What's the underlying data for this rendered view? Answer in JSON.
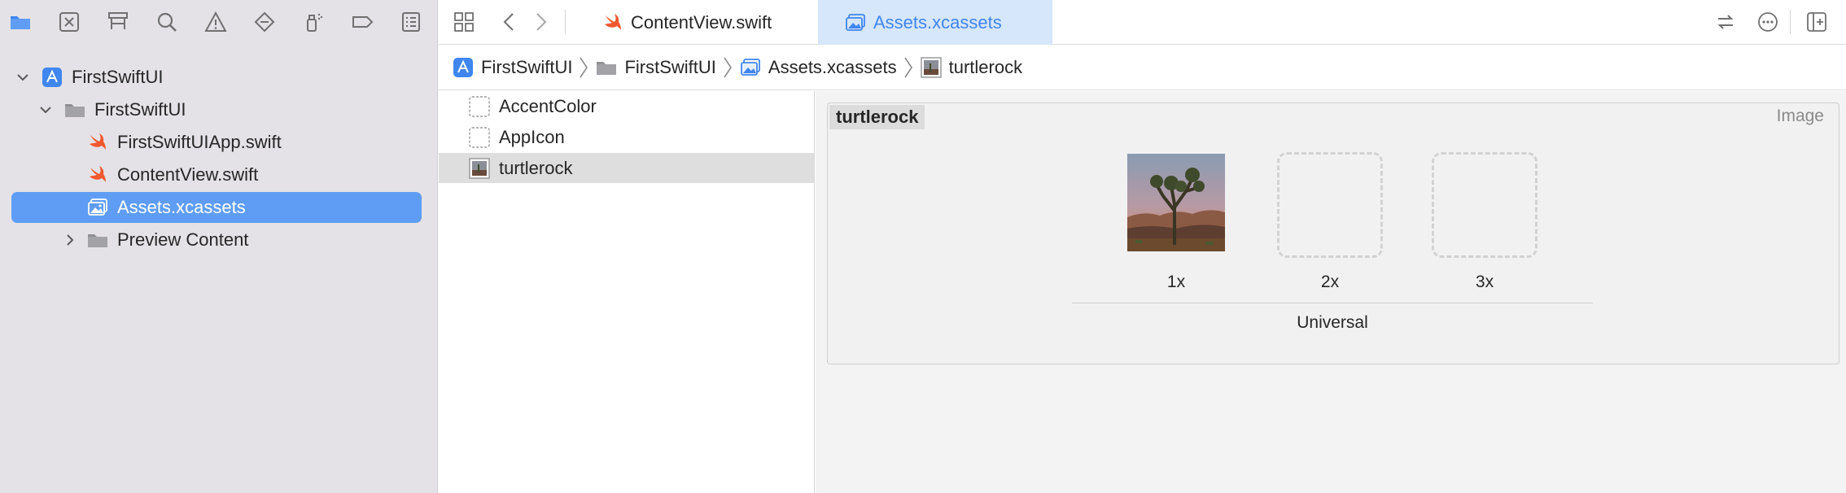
{
  "colors": {
    "accent": "#5e9df3",
    "swift": "#f0582d",
    "folder": "#8f8f94",
    "tab_active_bg": "#d6e6fb",
    "tab_active_text": "#3f86ee"
  },
  "navigator": {
    "toolbar_icons": [
      "folder-icon",
      "source-control-icon",
      "hierarchy-icon",
      "search-icon",
      "warning-icon",
      "test-diamond-icon",
      "debug-spray-icon",
      "breakpoint-icon",
      "report-icon"
    ],
    "tree": [
      {
        "label": "FirstSwiftUI",
        "icon": "xcode-project-icon",
        "expanded": true
      },
      {
        "label": "FirstSwiftUI",
        "icon": "folder-icon",
        "expanded": true
      },
      {
        "label": "FirstSwiftUIApp.swift",
        "icon": "swift-file-icon"
      },
      {
        "label": "ContentView.swift",
        "icon": "swift-file-icon"
      },
      {
        "label": "Assets.xcassets",
        "icon": "asset-catalog-icon",
        "selected": true
      },
      {
        "label": "Preview Content",
        "icon": "folder-icon",
        "expanded": false
      }
    ]
  },
  "tabs": [
    {
      "label": "ContentView.swift",
      "icon": "swift-file-icon",
      "active": false
    },
    {
      "label": "Assets.xcassets",
      "icon": "asset-catalog-icon",
      "active": true
    }
  ],
  "breadcrumb": [
    {
      "label": "FirstSwiftUI",
      "icon": "xcode-project-icon"
    },
    {
      "label": "FirstSwiftUI",
      "icon": "folder-icon"
    },
    {
      "label": "Assets.xcassets",
      "icon": "asset-catalog-icon"
    },
    {
      "label": "turtlerock",
      "icon": "image-thumbnail-icon"
    }
  ],
  "assets": [
    {
      "label": "AccentColor",
      "icon": "color-set-icon"
    },
    {
      "label": "AppIcon",
      "icon": "app-icon-set-icon"
    },
    {
      "label": "turtlerock",
      "icon": "image-thumbnail-icon",
      "selected": true
    }
  ],
  "image_set": {
    "name": "turtlerock",
    "kind": "Image",
    "slots": [
      {
        "label": "1x",
        "filled": true
      },
      {
        "label": "2x",
        "filled": false
      },
      {
        "label": "3x",
        "filled": false
      }
    ],
    "idiom": "Universal"
  }
}
